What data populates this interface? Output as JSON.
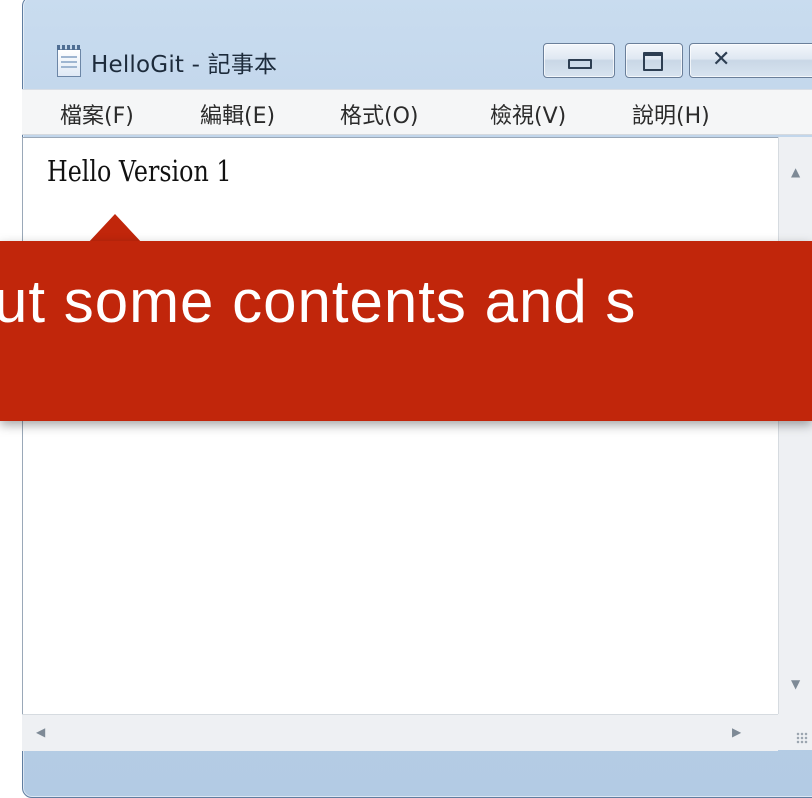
{
  "window": {
    "title": "HelloGit - 記事本",
    "app_icon": "notepad-icon",
    "buttons": {
      "minimize_icon": "minimize-icon",
      "maximize_icon": "maximize-icon",
      "close_icon": "close-icon",
      "close_glyph": "✕"
    }
  },
  "menubar": {
    "items": [
      {
        "label": "檔案(F)"
      },
      {
        "label": "編輯(E)"
      },
      {
        "label": "格式(O)"
      },
      {
        "label": "檢視(V)"
      },
      {
        "label": "說明(H)"
      }
    ]
  },
  "editor": {
    "content": "Hello Version 1"
  },
  "scrollbars": {
    "up_arrow": "▲",
    "down_arrow": "▼",
    "left_arrow": "◀",
    "right_arrow": "▶"
  },
  "callout": {
    "text": "ut some contents and s",
    "color": "#c1260b"
  }
}
